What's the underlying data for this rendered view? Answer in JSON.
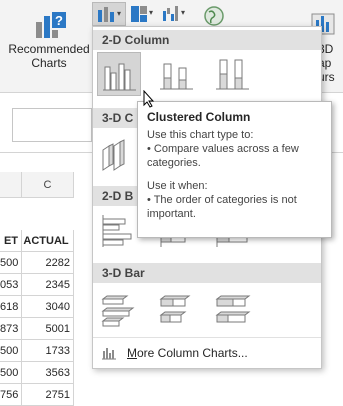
{
  "ribbon": {
    "recommended_label_line1": "Recommended",
    "recommended_label_line2": "Charts",
    "right_label_line1": "3D",
    "right_label_line2": "ap",
    "right_label_line3": "urs"
  },
  "sheet": {
    "column_header_c": "C",
    "header_b": "ET",
    "header_c": "ACTUAL",
    "rows": [
      {
        "b": "500",
        "c": "2282"
      },
      {
        "b": "053",
        "c": "2345"
      },
      {
        "b": "618",
        "c": "3040"
      },
      {
        "b": "873",
        "c": "5001"
      },
      {
        "b": "500",
        "c": "1733"
      },
      {
        "b": "500",
        "c": "3563"
      },
      {
        "b": "756",
        "c": "2751"
      }
    ]
  },
  "gallery": {
    "section_2d_column": "2-D Column",
    "section_3d_column": "3-D C",
    "section_2d_bar": "2-D B",
    "section_3d_bar": "3-D Bar",
    "more_link_prefix": "M",
    "more_link_rest": "ore Column Charts..."
  },
  "tooltip": {
    "title": "Clustered Column",
    "use_to": "Use this chart type to:",
    "use_to_item": "• Compare values across a few categories.",
    "use_when": "Use it when:",
    "use_when_item": "• The order of categories is not important."
  },
  "colors": {
    "ribbon_bg": "#f3f3f3",
    "section_header_bg": "#e1e1e1",
    "selected_thumb_bg": "#d5d5d5",
    "accent_blue": "#2b78c5",
    "icon_gray": "#8c8c8c"
  }
}
